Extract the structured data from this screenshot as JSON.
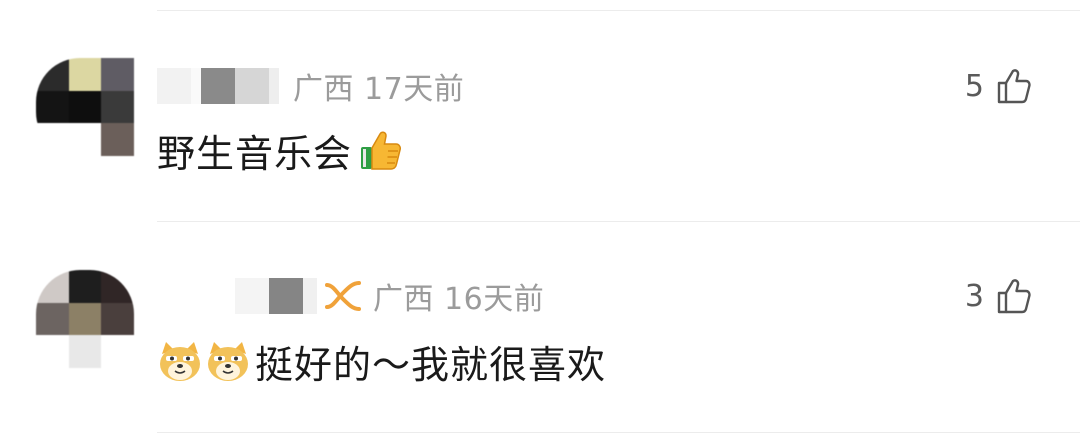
{
  "comments": [
    {
      "location": "广西",
      "time": "17天前",
      "likes": "5",
      "text": "野生音乐会",
      "trailing_emoji": "thumbs-up-emoji",
      "has_badge": false
    },
    {
      "location": "广西",
      "time": "16天前",
      "likes": "3",
      "text": "挺好的～我就很喜欢",
      "leading_emoji": [
        "doge-emoji",
        "doge-emoji"
      ],
      "has_badge": true,
      "badge_color": "#f0a23a"
    }
  ],
  "colors": {
    "meta_text": "#9b9b9b",
    "body_text": "#1a1a1a",
    "divider": "#ececec"
  }
}
